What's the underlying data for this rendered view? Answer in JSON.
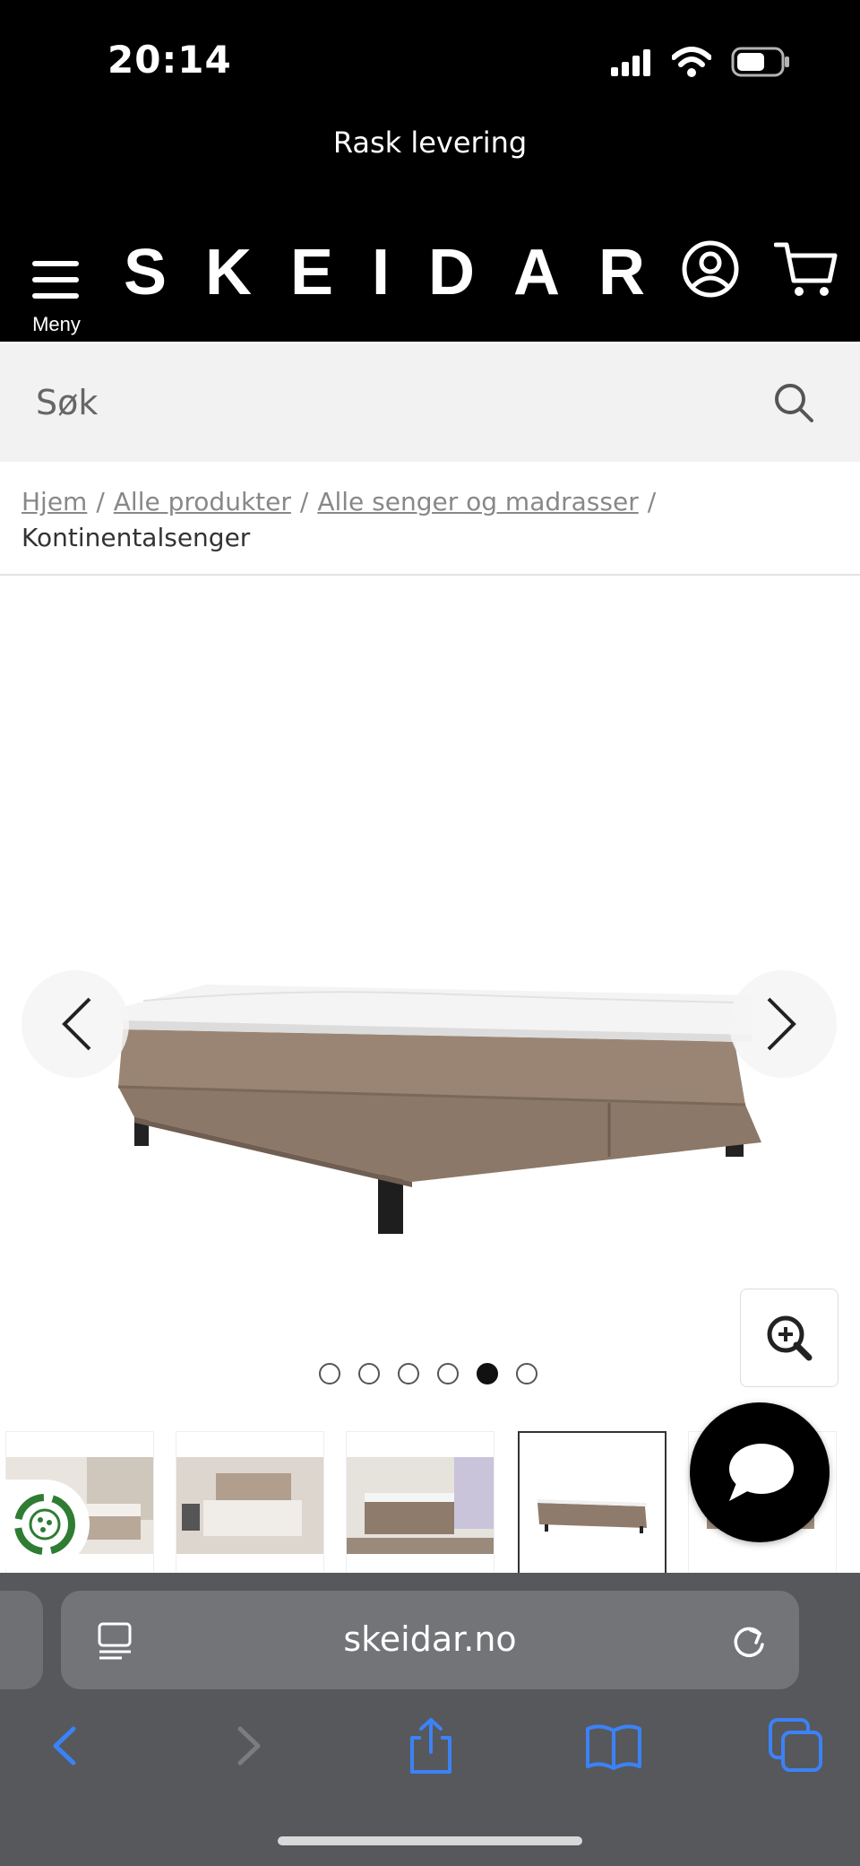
{
  "status_bar": {
    "time": "20:14"
  },
  "promo": {
    "text": "Rask levering"
  },
  "header": {
    "menu_label": "Meny",
    "logo_text": "SKEIDAR"
  },
  "search": {
    "placeholder": "Søk"
  },
  "breadcrumb": {
    "items": [
      "Hjem",
      "Alle produkter",
      "Alle senger og madrasser"
    ],
    "current": "Kontinentalsenger"
  },
  "gallery": {
    "image_count": 6,
    "active_index": 5
  },
  "thumbnails": {
    "selected_index": 4
  },
  "browser": {
    "url": "skeidar.no"
  },
  "colors": {
    "header_bg": "#000000",
    "browser_bg": "#56585c",
    "browser_accent": "#3b82f6",
    "bed_fabric": "#8f7b6c"
  }
}
